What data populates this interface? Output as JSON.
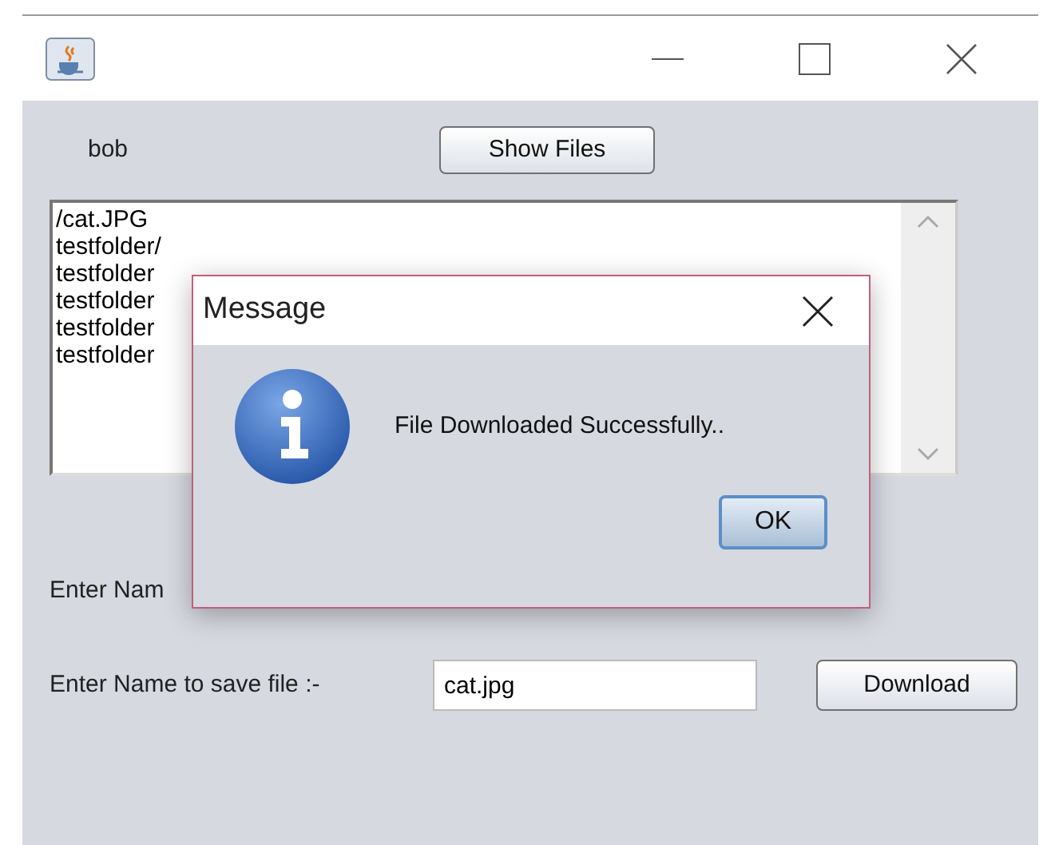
{
  "user_label": "bob",
  "show_files_button": "Show Files",
  "file_list": {
    "items": [
      "/cat.JPG",
      "testfolder/",
      "testfolder",
      "testfolder",
      "testfolder",
      "testfolder"
    ]
  },
  "name_row": {
    "label": "Enter Nam"
  },
  "save_row": {
    "label": "Enter Name to save file :-",
    "value": "cat.jpg",
    "button": "Download"
  },
  "dialog": {
    "title": "Message",
    "message": "File Downloaded Successfully..",
    "button": "OK"
  }
}
